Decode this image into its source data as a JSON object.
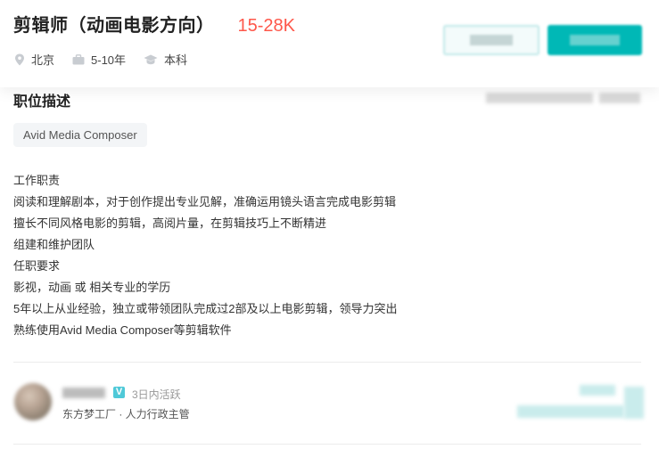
{
  "job": {
    "title": "剪辑师（动画电影方向）",
    "salary": "15-28K",
    "location": "北京",
    "experience": "5-10年",
    "education": "本科"
  },
  "section": {
    "title": "职位描述"
  },
  "tags": [
    "Avid Media Composer"
  ],
  "description": [
    "工作职责",
    "阅读和理解剧本，对于创作提出专业见解，准确运用镜头语言完成电影剪辑",
    "擅长不同风格电影的剪辑，高阅片量，在剪辑技巧上不断精进",
    "组建和维护团队",
    "任职要求",
    "影视，动画 或 相关专业的学历",
    "5年以上从业经验，独立或带领团队完成过2部及以上电影剪辑，领导力突出",
    "熟练使用Avid Media Composer等剪辑软件"
  ],
  "recruiter": {
    "verified_mark": "V",
    "active_status": "3日内活跃",
    "company_role": "东方梦工厂 · 人力行政主管"
  },
  "icons": {
    "location": "location-pin-icon",
    "experience": "briefcase-icon",
    "education": "graduation-cap-icon"
  },
  "colors": {
    "salary": "#fe574a",
    "primary": "#00b8b6",
    "verified": "#4fc9d8"
  }
}
